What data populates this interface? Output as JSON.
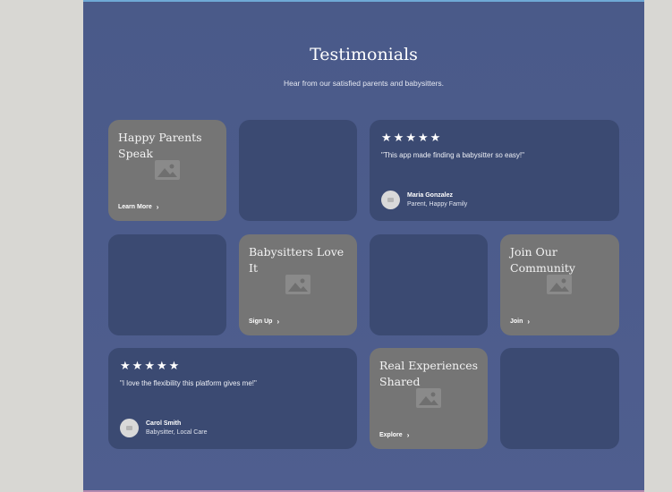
{
  "header": {
    "title": "Testimonials",
    "subtitle": "Hear from our satisfied parents and babysitters."
  },
  "cards": {
    "parents": {
      "title": "Happy Parents Speak",
      "cta": "Learn More"
    },
    "sitters": {
      "title": "Babysitters Love It",
      "cta": "Sign Up"
    },
    "community": {
      "title": "Join Our Community",
      "cta": "Join"
    },
    "experiences": {
      "title": "Real Experiences Shared",
      "cta": "Explore"
    }
  },
  "testimonials": [
    {
      "rating": 5,
      "quote": "\"This app made finding a babysitter so easy!\"",
      "name": "Maria Gonzalez",
      "role": "Parent, Happy Family"
    },
    {
      "rating": 5,
      "quote": "\"I love the flexibility this platform gives me!\"",
      "name": "Carol Smith",
      "role": "Babysitter, Local Care"
    }
  ],
  "icons": {
    "star": "star-icon",
    "chevron": "chevron-right-icon",
    "image": "image-placeholder-icon",
    "avatar": "avatar-placeholder-icon"
  },
  "colors": {
    "panel": "#4c5b8c",
    "card_dark": "#3b4a72",
    "card_gray": "#757575",
    "text": "#ffffff"
  }
}
